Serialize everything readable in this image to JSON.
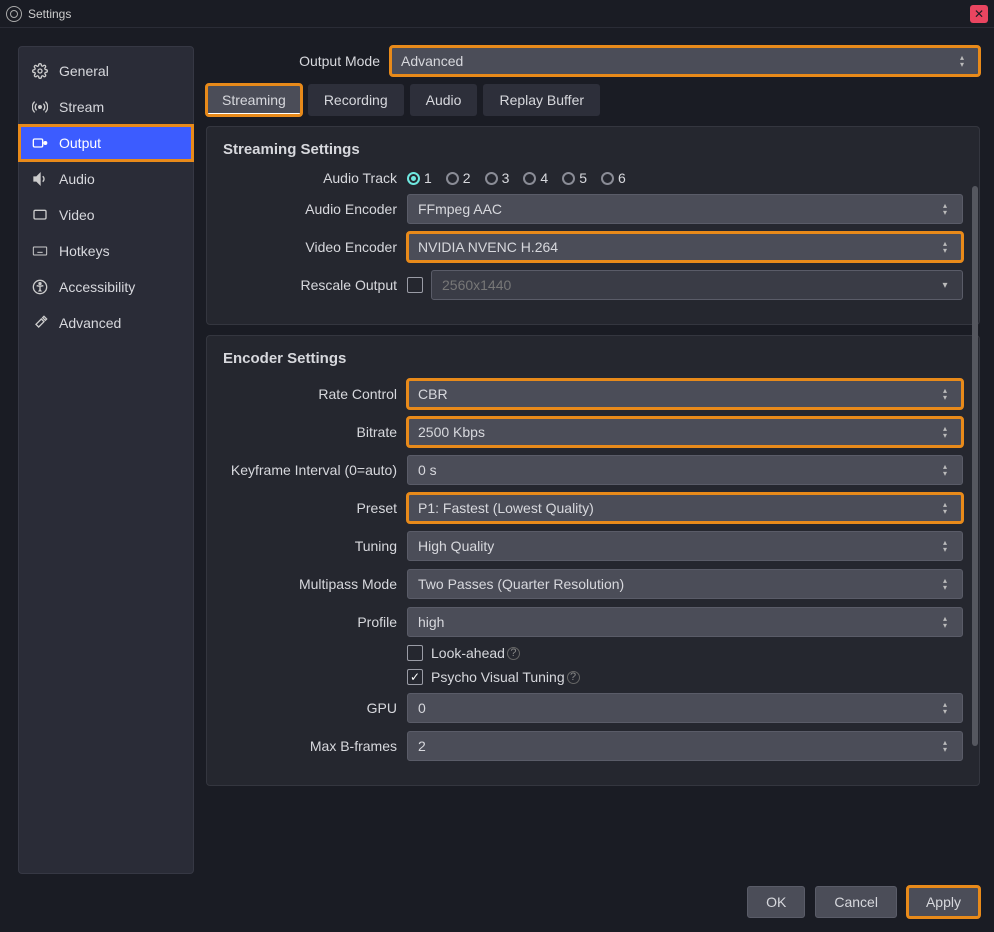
{
  "window": {
    "title": "Settings"
  },
  "sidebar": {
    "items": [
      {
        "label": "General"
      },
      {
        "label": "Stream"
      },
      {
        "label": "Output"
      },
      {
        "label": "Audio"
      },
      {
        "label": "Video"
      },
      {
        "label": "Hotkeys"
      },
      {
        "label": "Accessibility"
      },
      {
        "label": "Advanced"
      }
    ]
  },
  "output_mode": {
    "label": "Output Mode",
    "value": "Advanced"
  },
  "tabs": [
    {
      "label": "Streaming"
    },
    {
      "label": "Recording"
    },
    {
      "label": "Audio"
    },
    {
      "label": "Replay Buffer"
    }
  ],
  "streaming": {
    "title": "Streaming Settings",
    "audio_track": {
      "label": "Audio Track",
      "options": [
        "1",
        "2",
        "3",
        "4",
        "5",
        "6"
      ],
      "selected": "1"
    },
    "audio_encoder": {
      "label": "Audio Encoder",
      "value": "FFmpeg AAC"
    },
    "video_encoder": {
      "label": "Video Encoder",
      "value": "NVIDIA NVENC H.264"
    },
    "rescale": {
      "label": "Rescale Output",
      "checked": false,
      "value": "2560x1440"
    }
  },
  "encoder": {
    "title": "Encoder Settings",
    "rate_control": {
      "label": "Rate Control",
      "value": "CBR"
    },
    "bitrate": {
      "label": "Bitrate",
      "value": "2500 Kbps"
    },
    "keyframe": {
      "label": "Keyframe Interval (0=auto)",
      "value": "0 s"
    },
    "preset": {
      "label": "Preset",
      "value": "P1: Fastest (Lowest Quality)"
    },
    "tuning": {
      "label": "Tuning",
      "value": "High Quality"
    },
    "multipass": {
      "label": "Multipass Mode",
      "value": "Two Passes (Quarter Resolution)"
    },
    "profile": {
      "label": "Profile",
      "value": "high"
    },
    "lookahead": {
      "label": "Look-ahead",
      "checked": false
    },
    "psycho": {
      "label": "Psycho Visual Tuning",
      "checked": true
    },
    "gpu": {
      "label": "GPU",
      "value": "0"
    },
    "bframes": {
      "label": "Max B-frames",
      "value": "2"
    }
  },
  "footer": {
    "ok": "OK",
    "cancel": "Cancel",
    "apply": "Apply"
  }
}
